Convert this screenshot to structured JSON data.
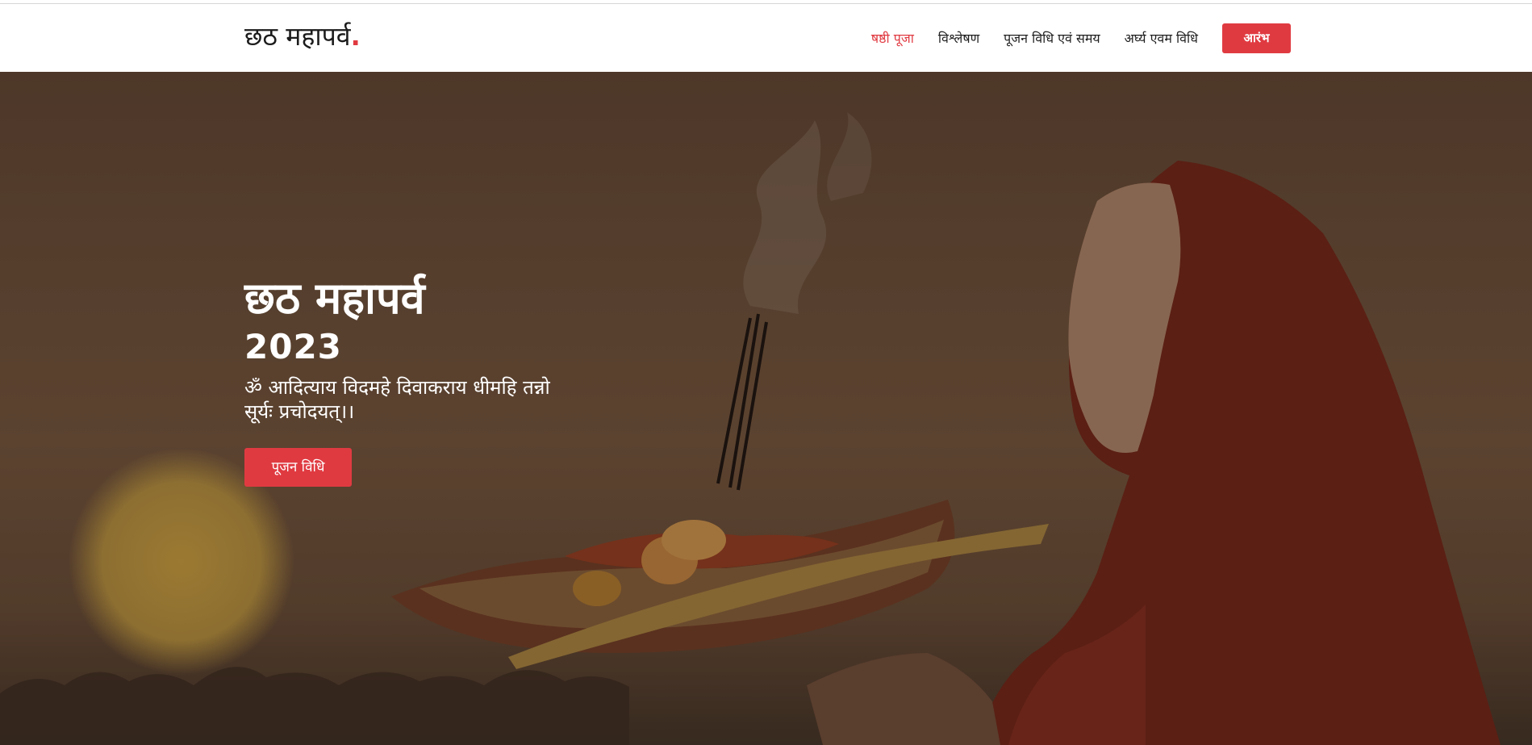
{
  "navbar": {
    "brand": "छठ महापर्व",
    "brand_dot": ".",
    "links": [
      {
        "label": "षष्ठी पूजा",
        "active": true
      },
      {
        "label": "विश्लेषण",
        "active": false
      },
      {
        "label": "पूजन विधि एवं समय",
        "active": false
      },
      {
        "label": "अर्घ्य एवम विधि",
        "active": false
      }
    ],
    "cta_label": "आरंभ"
  },
  "hero": {
    "title": "छठ महापर्व",
    "year": "2023",
    "mantra": "ॐ आदित्याय विदमहे दिवाकराय धीमहि तन्नो सूर्यः प्रचोदयत्।।",
    "button_label": "पूजन विधि"
  },
  "colors": {
    "accent": "#e03a41",
    "nav_text": "#1f1f1f",
    "hero_text": "#ffffff",
    "hero_background": "#5f4633"
  }
}
